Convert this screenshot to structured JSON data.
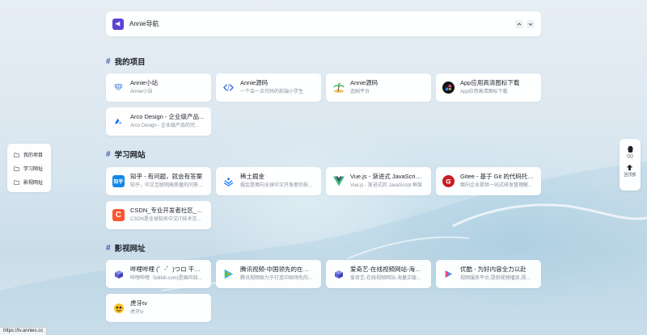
{
  "header": {
    "title": "Annie导航"
  },
  "colors": {
    "accent": "#3f51b5",
    "brand": "#5b43d6"
  },
  "sections": [
    {
      "title": "我的项目",
      "items": [
        {
          "name": "Annie小站",
          "desc": "Annie小站",
          "icon": "diamond-icon"
        },
        {
          "name": "Annie源码",
          "desc": "一个会一点代码的前端小学生",
          "icon": "code-icon"
        },
        {
          "name": "Annie源码",
          "desc": "追剧平台",
          "icon": "island-icon"
        },
        {
          "name": "App应用高清图标下载",
          "desc": "App应用高清图标下载",
          "icon": "app-icon"
        },
        {
          "name": "Arco Design - 企业级产品...",
          "desc": "Arco Design - 企业级产品的完...",
          "icon": "arco-icon"
        }
      ]
    },
    {
      "title": "学习网站",
      "items": [
        {
          "name": "知乎 - 有问题，就会有答案",
          "desc": "知乎，中文互联网高质量的问答...",
          "icon": "zhihu-icon",
          "icon_text": "知乎"
        },
        {
          "name": "稀土掘金",
          "desc": "掘金是面向全球中文开发者的技...",
          "icon": "juejin-icon"
        },
        {
          "name": "Vue.js - 渐进式 JavaScript ...",
          "desc": "Vue.js - 渐进式的 JavaScript 框架",
          "icon": "vue-icon"
        },
        {
          "name": "Gitee - 基于 Git 的代码托管...",
          "desc": "面向企业提供一站式研发管理解...",
          "icon": "gitee-icon"
        },
        {
          "name": "CSDN_专业开发者社区_已...",
          "desc": "CSDN是全球知名中文IT技术交...",
          "icon": "csdn-icon",
          "icon_text": "C"
        }
      ]
    },
    {
      "title": "影视网址",
      "items": [
        {
          "name": "哔哩哔哩 (゜-゜)つロ 干杯~...",
          "desc": "哔哩哔哩（bilibili.com)是国内知...",
          "icon": "cube-icon"
        },
        {
          "name": "腾讯视频-中国领先的在线视...",
          "desc": "腾讯视频致力于打造中国领先的...",
          "icon": "tencent-video-icon"
        },
        {
          "name": "爱奇艺-在线视频网站-海量...",
          "desc": "爱奇艺-在线视频网站-海量正版...",
          "icon": "cube-icon"
        },
        {
          "name": "优酷 - 为好内容全力以赴",
          "desc": "视频服务平台,提供视频播放,视频...",
          "icon": "youku-icon"
        },
        {
          "name": "虎牙tv",
          "desc": "虎牙tv",
          "icon": "huya-icon"
        }
      ]
    }
  ],
  "sidenav": {
    "items": [
      "我的项目",
      "学习网址",
      "影视网址"
    ]
  },
  "float": {
    "qq_label": "QQ",
    "top_label": "回顶部"
  },
  "status": {
    "url": "https://tv.annies.cc"
  }
}
